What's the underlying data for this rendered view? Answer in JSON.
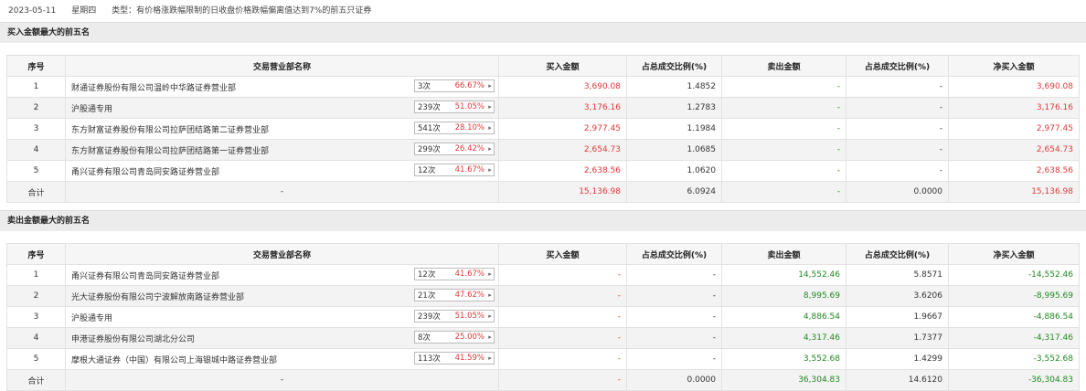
{
  "header": {
    "date": "2023-05-11",
    "weekday": "星期四",
    "type_text": "类型：有价格涨跌幅限制的日收盘价格跌幅偏离值达到7%的前五只证券"
  },
  "columns": {
    "seq": "序号",
    "name": "交易营业部名称",
    "buy": "买入金额",
    "buy_ratio": "占总成交比例(%)",
    "sell": "卖出金额",
    "sell_ratio": "占总成交比例(%)",
    "net": "净买入金额"
  },
  "buy_section": {
    "title": "买入金额最大的前五名",
    "rows": [
      {
        "seq": "1",
        "name": "财通证券股份有限公司温岭中华路证券营业部",
        "count": "3次",
        "pct": "66.67%",
        "buy": "3,690.08",
        "buy_ratio": "1.4852",
        "sell": "-",
        "sell_ratio": "-",
        "net": "3,690.08"
      },
      {
        "seq": "2",
        "name": "沪股通专用",
        "count": "239次",
        "pct": "51.05%",
        "buy": "3,176.16",
        "buy_ratio": "1.2783",
        "sell": "-",
        "sell_ratio": "-",
        "net": "3,176.16"
      },
      {
        "seq": "3",
        "name": "东方财富证券股份有限公司拉萨团结路第二证券营业部",
        "count": "541次",
        "pct": "28.10%",
        "buy": "2,977.45",
        "buy_ratio": "1.1984",
        "sell": "-",
        "sell_ratio": "-",
        "net": "2,977.45"
      },
      {
        "seq": "4",
        "name": "东方财富证券股份有限公司拉萨团结路第一证券营业部",
        "count": "299次",
        "pct": "26.42%",
        "buy": "2,654.73",
        "buy_ratio": "1.0685",
        "sell": "-",
        "sell_ratio": "-",
        "net": "2,654.73"
      },
      {
        "seq": "5",
        "name": "甬兴证券有限公司青岛同安路证券营业部",
        "count": "12次",
        "pct": "41.67%",
        "buy": "2,638.56",
        "buy_ratio": "1.0620",
        "sell": "-",
        "sell_ratio": "-",
        "net": "2,638.56"
      }
    ],
    "total": {
      "label": "合计",
      "name": "-",
      "buy": "15,136.98",
      "buy_ratio": "6.0924",
      "sell": "-",
      "sell_ratio": "0.0000",
      "net": "15,136.98"
    }
  },
  "sell_section": {
    "title": "卖出金额最大的前五名",
    "rows": [
      {
        "seq": "1",
        "name": "甬兴证券有限公司青岛同安路证券营业部",
        "count": "12次",
        "pct": "41.67%",
        "buy": "-",
        "buy_ratio": "-",
        "sell": "14,552.46",
        "sell_ratio": "5.8571",
        "net": "-14,552.46"
      },
      {
        "seq": "2",
        "name": "光大证券股份有限公司宁波解放南路证券营业部",
        "count": "21次",
        "pct": "47.62%",
        "buy": "-",
        "buy_ratio": "-",
        "sell": "8,995.69",
        "sell_ratio": "3.6206",
        "net": "-8,995.69"
      },
      {
        "seq": "3",
        "name": "沪股通专用",
        "count": "239次",
        "pct": "51.05%",
        "buy": "-",
        "buy_ratio": "-",
        "sell": "4,886.54",
        "sell_ratio": "1.9667",
        "net": "-4,886.54"
      },
      {
        "seq": "4",
        "name": "申港证券股份有限公司湖北分公司",
        "count": "8次",
        "pct": "25.00%",
        "buy": "-",
        "buy_ratio": "-",
        "sell": "4,317.46",
        "sell_ratio": "1.7377",
        "net": "-4,317.46"
      },
      {
        "seq": "5",
        "name": "摩根大通证券（中国）有限公司上海银城中路证券营业部",
        "count": "113次",
        "pct": "41.59%",
        "buy": "-",
        "buy_ratio": "-",
        "sell": "3,552.68",
        "sell_ratio": "1.4299",
        "net": "-3,552.68"
      }
    ],
    "total": {
      "label": "合计",
      "name": "-",
      "buy": "-",
      "buy_ratio": "0.0000",
      "sell": "36,304.83",
      "sell_ratio": "14.6120",
      "net": "-36,304.83"
    }
  },
  "colors": {
    "positive": "#e03a3a",
    "negative": "#1f8a1f",
    "section_bg": "#ececec"
  }
}
